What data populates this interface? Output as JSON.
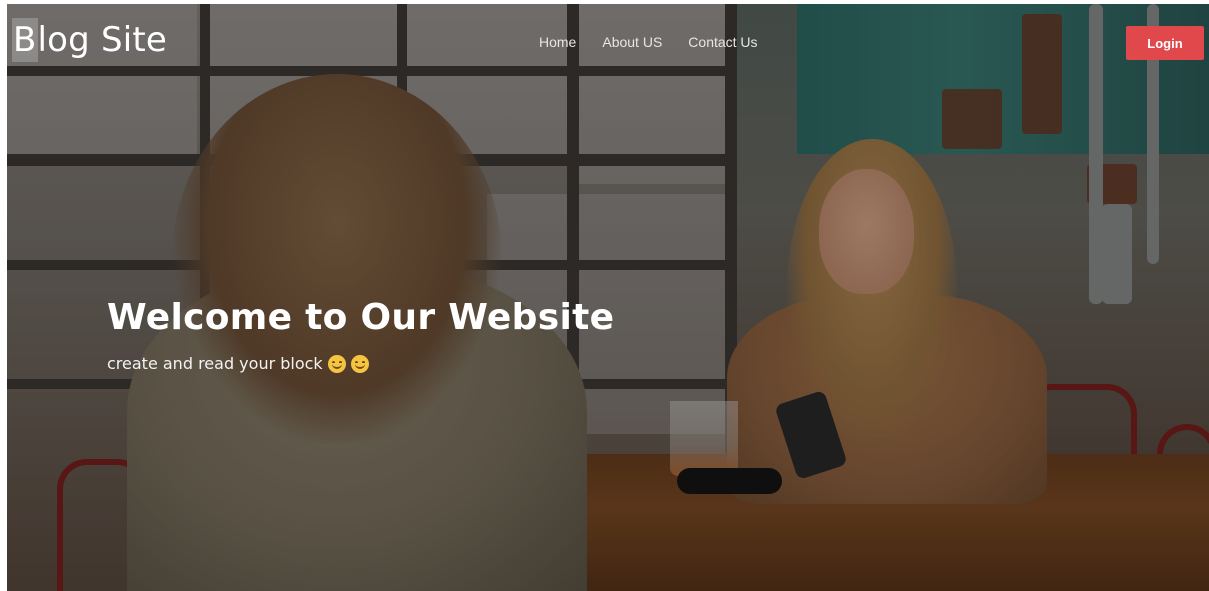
{
  "header": {
    "logo_text": "Blog Site",
    "logo_first_letter": "B",
    "logo_rest": "log Site",
    "nav": [
      {
        "label": "Home"
      },
      {
        "label": "About US"
      },
      {
        "label": "Contact Us"
      }
    ],
    "login_label": "Login"
  },
  "hero": {
    "title": "Welcome to Our Website",
    "subtitle": "create and read your block",
    "subtitle_icons": [
      "smiling-face-icon",
      "smiling-face-icon"
    ]
  },
  "colors": {
    "login_button": "#e0484b",
    "text": "#ffffff"
  }
}
